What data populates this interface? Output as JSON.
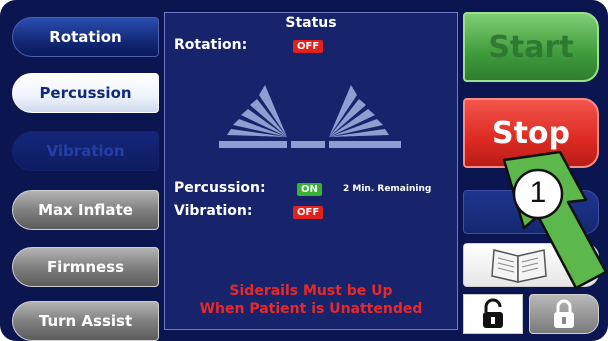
{
  "left_buttons": [
    {
      "label": "Rotation"
    },
    {
      "label": "Percussion"
    },
    {
      "label": "Vibration"
    },
    {
      "label": "Max Inflate"
    },
    {
      "label": "Firmness"
    },
    {
      "label": "Turn Assist"
    }
  ],
  "status": {
    "title": "Status",
    "rotation_label": "Rotation:",
    "rotation_state": "OFF",
    "percussion_label": "Percussion:",
    "percussion_state": "ON",
    "percussion_remaining": "2 Min. Remaining",
    "vibration_label": "Vibration:",
    "vibration_state": "OFF",
    "warning_line1": "Siderails Must be Up",
    "warning_line2": "When Patient is Unattended"
  },
  "right_buttons": {
    "start_label": "Start",
    "stop_label": "Stop"
  },
  "callout": {
    "number": "1"
  },
  "colors": {
    "background": "#0b1550",
    "panel": "#17246b",
    "off_badge": "#e0211e",
    "on_badge": "#37b233",
    "warning_text": "#e8282a",
    "start": "#3f9b3b",
    "stop": "#dd2a22",
    "callout_arrow": "#5cb84b"
  },
  "icons": [
    "bed-rotation-illustration",
    "manual-book-icon",
    "unlock-icon",
    "lock-icon",
    "callout-arrow-icon"
  ]
}
